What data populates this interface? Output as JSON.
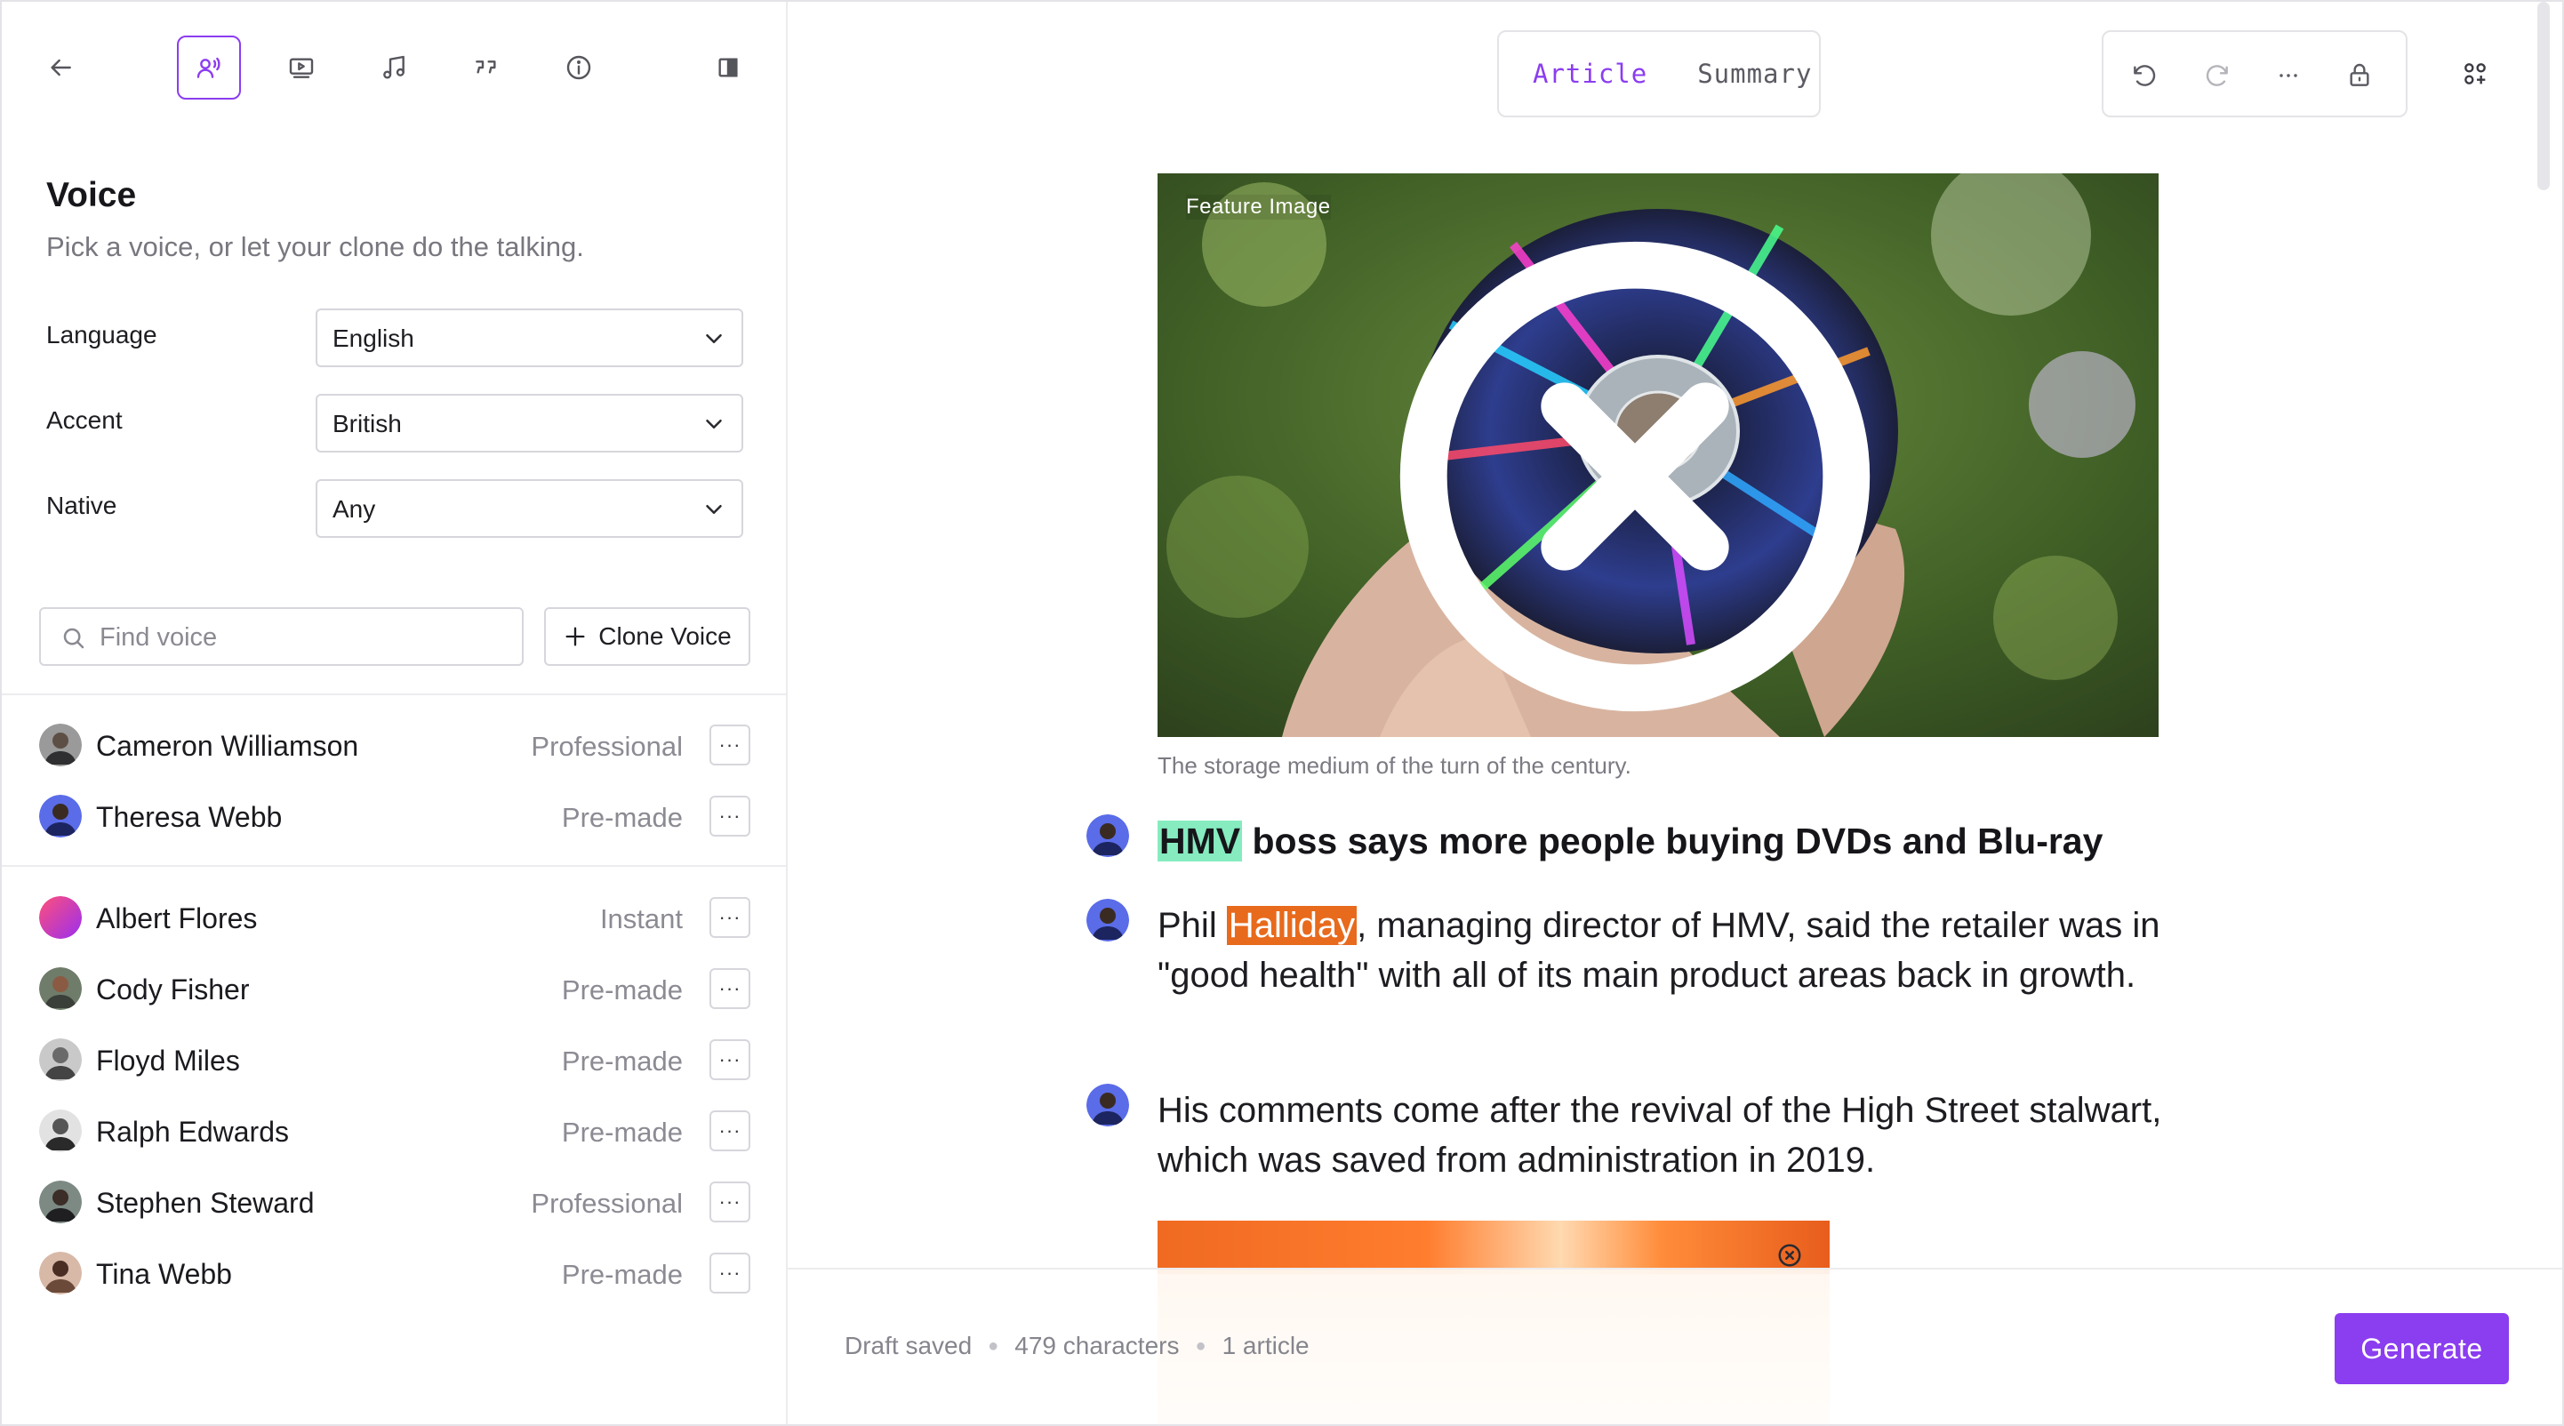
{
  "toolbar": {
    "icons": [
      "back-arrow-icon",
      "voice-icon",
      "video-icon",
      "music-note-icon",
      "quote-icon",
      "info-icon",
      "panel-toggle-icon"
    ],
    "active": "voice-icon"
  },
  "voice_panel": {
    "title": "Voice",
    "subtitle": "Pick a voice, or let your clone do the talking.",
    "language": {
      "label": "Language",
      "value": "English"
    },
    "accent": {
      "label": "Accent",
      "value": "British"
    },
    "native": {
      "label": "Native",
      "value": "Any"
    },
    "search_placeholder": "Find voice",
    "clone_label": "Clone Voice"
  },
  "voices": [
    {
      "name": "Cameron Williamson",
      "type": "Professional"
    },
    {
      "name": "Theresa Webb",
      "type": "Pre-made"
    },
    {
      "name": "Albert Flores",
      "type": "Instant"
    },
    {
      "name": "Cody Fisher",
      "type": "Pre-made"
    },
    {
      "name": "Floyd Miles",
      "type": "Pre-made"
    },
    {
      "name": "Ralph Edwards",
      "type": "Pre-made"
    },
    {
      "name": "Stephen Steward",
      "type": "Professional"
    },
    {
      "name": "Tina Webb",
      "type": "Pre-made"
    }
  ],
  "tabs": {
    "article": "Article",
    "summary": "Summary",
    "active": "Article"
  },
  "article": {
    "feature_tag": "Feature Image",
    "caption": "The storage medium of the turn of the century.",
    "headline_highlight": "HMV",
    "headline_rest": " boss says more people buying DVDs and Blu-ray",
    "p1_before": "Phil ",
    "p1_highlight": "Halliday",
    "p1_after": ", managing director of HMV, said the retailer was in \"good health\" with all of its main product areas back in growth.",
    "p2": "His comments come after the revival of the High Street stalwart, which was saved from administration in 2019."
  },
  "footer": {
    "draft": "Draft saved",
    "characters": "479 characters",
    "articles": "1 article",
    "generate": "Generate"
  },
  "colors": {
    "accent": "#8b3df0",
    "highlight_green": "#86ecc0",
    "highlight_orange": "#e86a1c"
  }
}
